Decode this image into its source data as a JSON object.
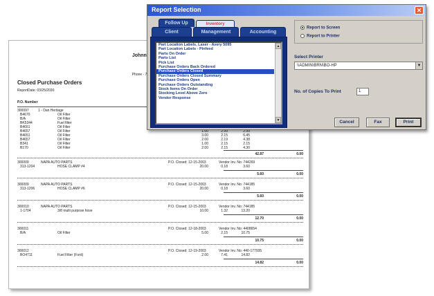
{
  "report": {
    "company": "Johnny's A",
    "header_lines": [
      "H",
      "East C",
      "Phone - 769-786"
    ],
    "title": "Closed Purchase Orders",
    "report_date": "ReportDate: 03/25/2030",
    "po_number_label": "P.O. Number",
    "first_po": {
      "number": "300097",
      "vendor": "1 - Dan Heritage",
      "lines": [
        {
          "part": "B4670",
          "desc": "Oil Filter",
          "qty": "",
          "price": "",
          "ext": ""
        },
        {
          "part": "B/A",
          "desc": "Oil Filter",
          "qty": "",
          "price": "",
          "ext": ""
        },
        {
          "part": "BK5344",
          "desc": "Fuel filter",
          "qty": "",
          "price": "",
          "ext": ""
        },
        {
          "part": "B4651",
          "desc": "Oil Filter",
          "qty": "2.00",
          "price": "2.15",
          "ext": "4.30"
        },
        {
          "part": "B4657",
          "desc": "Oil Filter",
          "qty": "1.00",
          "price": "2.99",
          "ext": "2.99"
        },
        {
          "part": "B4651",
          "desc": "Oil Filter",
          "qty": "3.00",
          "price": "2.15",
          "ext": "6.45"
        },
        {
          "part": "B4657",
          "desc": "Oil Filter",
          "qty": "2.00",
          "price": "2.19",
          "ext": "4.38"
        },
        {
          "part": "B341",
          "desc": "Oil Filter",
          "qty": "1.00",
          "price": "2.15",
          "ext": "2.15"
        },
        {
          "part": "B170",
          "desc": "Oil Filter",
          "qty": "2.00",
          "price": "2.15",
          "ext": "4.30"
        }
      ],
      "total": "42.87",
      "total2": "0.00"
    },
    "orders": [
      {
        "number": "300009",
        "vendor": "NAPA AUTO PARTS",
        "closed": "P.O. Closed: 12-15-2003",
        "vendor_inv": "Vendor Inv. No: 744269",
        "part": "313-1204",
        "desc": "HOSE CLAMP #4",
        "qty": "20.00",
        "price": "0.18",
        "ext": "3.60",
        "total": "5.60",
        "total2": "0.00"
      },
      {
        "number": "300009",
        "vendor": "NAPA AUTO PARTS",
        "closed": "P.O. Closed: 12-15-2003",
        "vendor_inv": "Vendor Inv. No: 744185",
        "part": "313-1206",
        "desc": "HOSE CLAMP #6",
        "qty": "20.00",
        "price": "0.18",
        "ext": "3.60",
        "total": "5.60",
        "total2": "0.00"
      },
      {
        "number": "300010",
        "vendor": "NAPA AUTO PARTS",
        "closed": "P.O. Closed: 12-15-2003",
        "vendor_inv": "Vendor Inv. No: 744185",
        "part": "1-1704",
        "desc": "3/8 multi purpose hose",
        "qty": "10.00",
        "price": "1.32",
        "ext": "13.20",
        "total": "12.70",
        "total2": "0.00"
      },
      {
        "number": "300011",
        "vendor": "",
        "closed": "P.O. Closed: 12-18-2003",
        "vendor_inv": "Vendor Inv. No: 4408654",
        "part": "B/A",
        "desc": "Oil Filter",
        "qty": "5.00",
        "price": "2.15",
        "ext": "10.75",
        "total": "10.75",
        "total2": "0.00"
      },
      {
        "number": "300012",
        "vendor": "",
        "closed": "P.O. Closed: 12-19-2003",
        "vendor_inv": "Vendor Inv. No: 440-177935",
        "part": "BO4711",
        "desc": "Fuel Filter (Ford)",
        "qty": "2.00",
        "price": "7.41",
        "ext": "14.82",
        "total": "14.82",
        "total2": "0.00"
      }
    ]
  },
  "dialog": {
    "title": "Report Selection",
    "close_icon": "close-icon",
    "tabs_row1": [
      "Follow Up",
      "Inventory"
    ],
    "tabs_row2": [
      "Client",
      "Management",
      "Accounting"
    ],
    "list_items": [
      "Part Location Labels, Laser - Avery 5095",
      "Part Location Labels - Pinfeed",
      "Parts On Order",
      "Parts List",
      "Pick List",
      "Purchase Orders Back Ordered",
      "Purchase Orders Closed",
      "Purchase Orders Closed Summary",
      "Purchase Orders Open",
      "Purchase Orders Outstanding",
      "Stock Items On Order",
      "Stocking Level Above Zero",
      "Vendor Response"
    ],
    "selected_index": 6,
    "report_to_screen": "Report to Screen",
    "report_to_printer": "Report to Printer",
    "select_printer_label": "Select Printer",
    "printer_value": "\\\\ADMIN\\BRN\\BO-HP",
    "copies_label": "No. of Copies To Print",
    "copies_value": "1",
    "cancel": "Cancel",
    "fax": "Fax",
    "print": "Print"
  }
}
